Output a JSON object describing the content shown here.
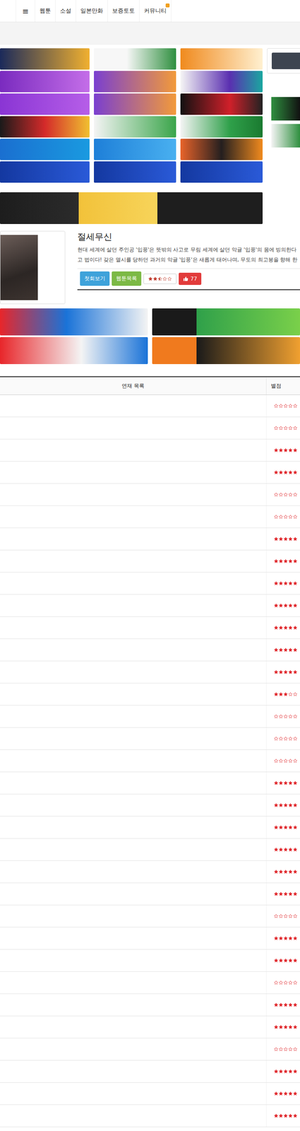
{
  "nav": {
    "menu_icon": "≡",
    "items": [
      {
        "label": "웹툰",
        "badge": false
      },
      {
        "label": "소설",
        "badge": false
      },
      {
        "label": "일본만화",
        "badge": false
      },
      {
        "label": "보증토토",
        "badge": false
      },
      {
        "label": "커뮤니티",
        "badge": true
      }
    ]
  },
  "detail": {
    "title": "절세무신",
    "description": [
      "현대 세계에 살던 주인공 '입풍'은 뜻밖의 사고로 무림 세계에 살던 악귤 '입풍'의 몸에 빙의한다",
      "고 법이다! 갖은 멸시를 당하던 과거의 악귤 '입풍'은 새롭게 태어나며, 무도의 최고봉을 향해 한"
    ],
    "buttons": [
      "첫회보기",
      "웹툰목록"
    ],
    "rating": {
      "stars": 2.5
    },
    "likes": {
      "count": "77"
    }
  },
  "table": {
    "columns": [
      "연재 목록",
      "별점"
    ],
    "rows": [
      {
        "stars": 0
      },
      {
        "stars": 0
      },
      {
        "stars": 5
      },
      {
        "stars": 5
      },
      {
        "stars": 0
      },
      {
        "stars": 0
      },
      {
        "stars": 5
      },
      {
        "stars": 5
      },
      {
        "stars": 5
      },
      {
        "stars": 5
      },
      {
        "stars": 5
      },
      {
        "stars": 5
      },
      {
        "stars": 5
      },
      {
        "stars": 3
      },
      {
        "stars": 0
      },
      {
        "stars": 0
      },
      {
        "stars": 0
      },
      {
        "stars": 5
      },
      {
        "stars": 5
      },
      {
        "stars": 5
      },
      {
        "stars": 5
      },
      {
        "stars": 5
      },
      {
        "stars": 5
      },
      {
        "stars": 0
      },
      {
        "stars": 5
      },
      {
        "stars": 5
      },
      {
        "stars": 0
      },
      {
        "stars": 5
      },
      {
        "stars": 5
      },
      {
        "stars": 0
      },
      {
        "stars": 5
      },
      {
        "stars": 5
      },
      {
        "stars": 5
      }
    ]
  }
}
